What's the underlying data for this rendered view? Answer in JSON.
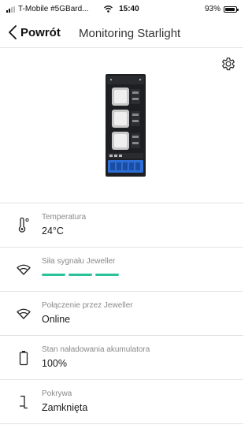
{
  "status_bar": {
    "carrier": "T-Mobile #5GBard...",
    "time": "15:40",
    "battery": "93%",
    "battery_level": 0.93
  },
  "nav": {
    "back_label": "Powrót",
    "title": "Monitoring Starlight"
  },
  "icons": {
    "back": "chevron-left-icon",
    "settings": "gear-icon"
  },
  "device_image": "ajax-transmitter-module",
  "rows": [
    {
      "icon": "thermometer-icon",
      "label": "Temperatura",
      "value": "24°C"
    },
    {
      "icon": "signal-icon",
      "label": "Siła sygnału Jeweller",
      "signal_bars": 3,
      "signal_max": 3,
      "signal_color": "#2bc29a"
    },
    {
      "icon": "signal-icon",
      "label": "Połączenie przez Jeweller",
      "value": "Online"
    },
    {
      "icon": "battery-icon",
      "label": "Stan naładowania akumulatora",
      "value": "100%"
    },
    {
      "icon": "lid-icon",
      "label": "Pokrywa",
      "value": "Zamknięta"
    }
  ]
}
